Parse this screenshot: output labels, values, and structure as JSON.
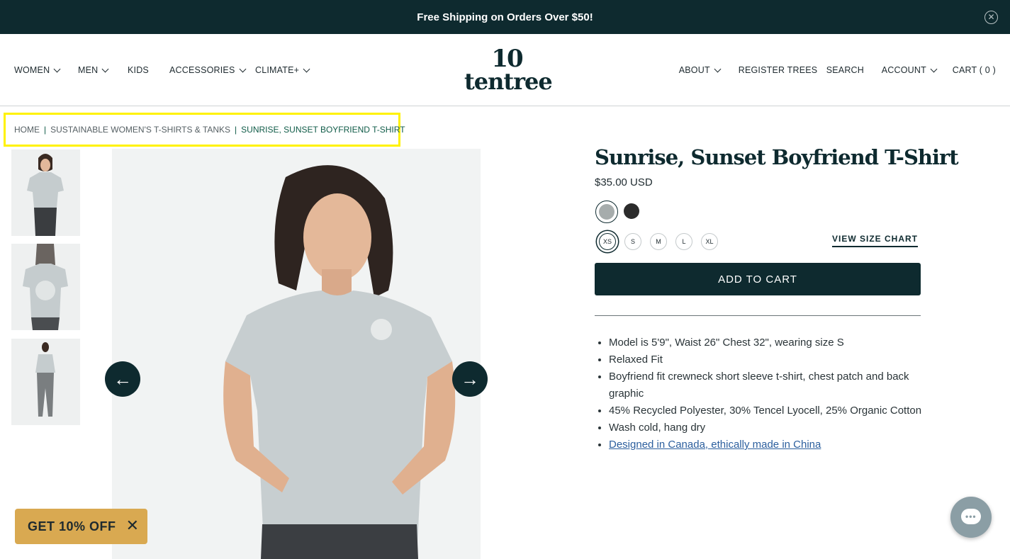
{
  "announcement": {
    "text": "Free Shipping on Orders Over $50!",
    "close_icon": "✕"
  },
  "header": {
    "logo_mark": "10",
    "logo_word": "tentree",
    "nav_left": [
      {
        "label": "WOMEN",
        "dropdown": true
      },
      {
        "label": "MEN",
        "dropdown": true
      },
      {
        "label": "KIDS",
        "dropdown": false
      },
      {
        "label": "ACCESSORIES",
        "dropdown": true
      },
      {
        "label": "CLIMATE+",
        "dropdown": true
      }
    ],
    "nav_right": [
      {
        "label": "ABOUT",
        "dropdown": true
      },
      {
        "label": "REGISTER TREES",
        "dropdown": false
      },
      {
        "label": "SEARCH",
        "dropdown": false
      },
      {
        "label": "ACCOUNT",
        "dropdown": true
      },
      {
        "label": "CART ( 0 )",
        "dropdown": false
      }
    ]
  },
  "breadcrumb": {
    "items": [
      "HOME",
      "SUSTAINABLE WOMEN'S T-SHIRTS & TANKS",
      "SUNRISE, SUNSET BOYFRIEND T-SHIRT"
    ],
    "separator": "|"
  },
  "gallery": {
    "prev_icon": "←",
    "next_icon": "→",
    "thumbnails": [
      "front-view",
      "back-view",
      "full-body-view"
    ]
  },
  "product": {
    "title": "Sunrise, Sunset Boyfriend T-Shirt",
    "price": "$35.00 USD",
    "colors": [
      {
        "name": "light-grey",
        "hex": "#a6acac",
        "selected": true
      },
      {
        "name": "black",
        "hex": "#2b2b2b",
        "selected": false
      }
    ],
    "sizes": [
      {
        "label": "XS",
        "selected": true
      },
      {
        "label": "S",
        "selected": false
      },
      {
        "label": "M",
        "selected": false
      },
      {
        "label": "L",
        "selected": false
      },
      {
        "label": "XL",
        "selected": false
      }
    ],
    "size_chart_label": "VIEW SIZE CHART",
    "add_to_cart_label": "ADD TO CART",
    "features": [
      "Model is 5'9\", Waist 26\" Chest 32\", wearing size S",
      "Relaxed Fit",
      "Boyfriend fit crewneck short sleeve t-shirt, chest patch and back graphic",
      "45% Recycled Polyester, 30% Tencel Lyocell, 25% Organic Cotton",
      "Wash cold, hang dry"
    ],
    "features_link": "Designed in Canada, ethically made in China"
  },
  "promo": {
    "label": "GET 10% OFF",
    "close_icon": "✕"
  },
  "chat": {
    "icon": "chat-icon",
    "dots": "•••"
  },
  "colors": {
    "brand_dark": "#0e2a2f",
    "accent_green": "#0f5b47",
    "promo_gold": "#d9a951",
    "highlight": "#fff200"
  }
}
